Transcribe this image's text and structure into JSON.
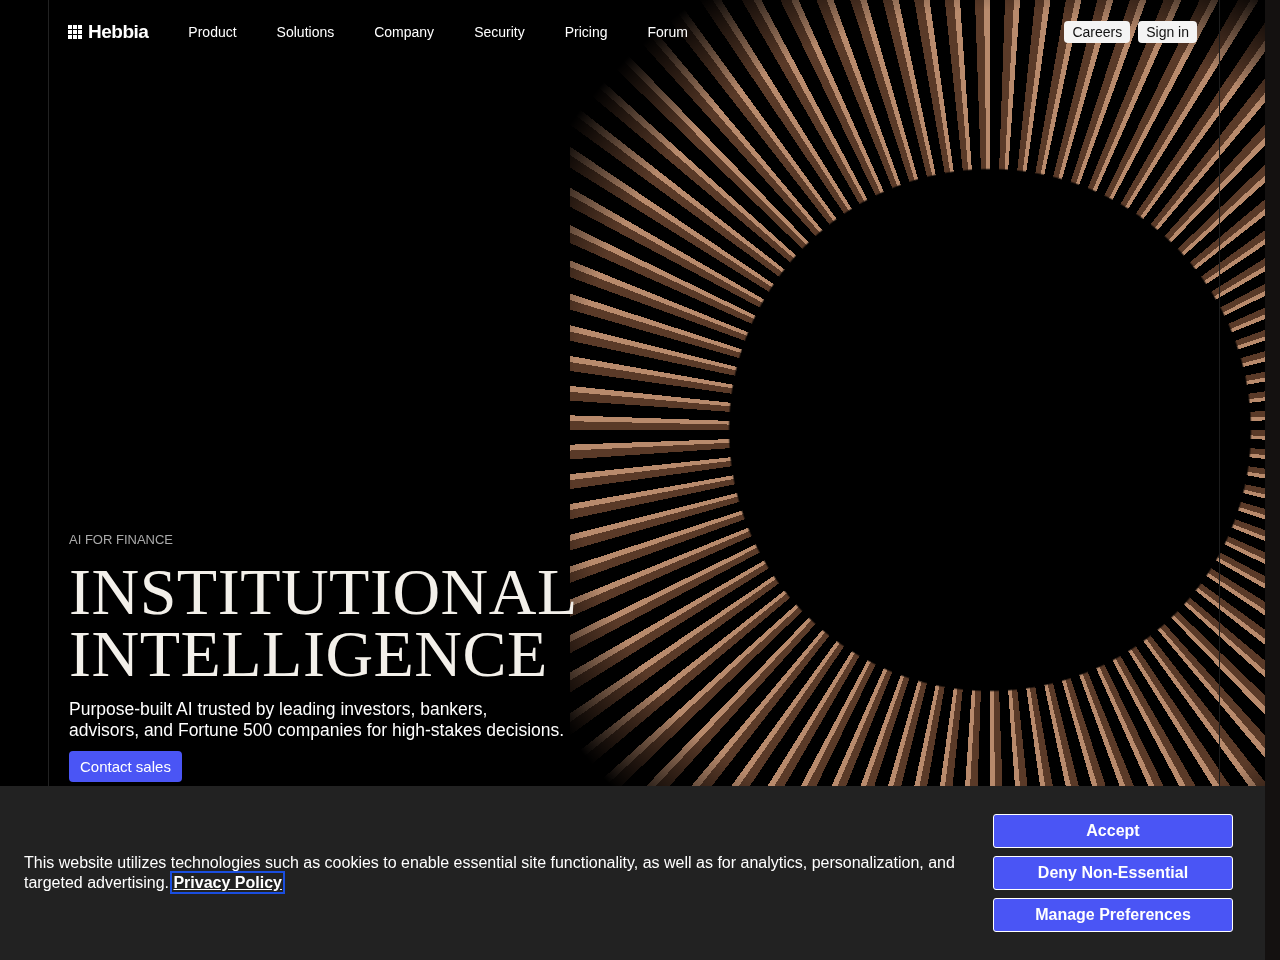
{
  "nav": {
    "logo": "Hebbia",
    "links": [
      "Product",
      "Solutions",
      "Company",
      "Security",
      "Pricing",
      "Forum"
    ],
    "actions": [
      "Careers",
      "Sign in"
    ]
  },
  "hero": {
    "eyebrow": "AI FOR FINANCE",
    "title_lines": [
      "INSTITUTIONAL",
      "INTELLIGENCE"
    ],
    "subtitle_lines": [
      "Purpose-built AI trusted by leading investors, bankers,",
      "advisors, and Fortune 500 companies for high-stakes decisions."
    ],
    "cta": "Contact sales"
  },
  "cookie_banner": {
    "text": "This website utilizes technologies such as cookies to enable essential site functionality, as well as for analytics, personalization, and targeted advertising.",
    "link": "Privacy Policy",
    "buttons": [
      "Accept",
      "Deny Non-Essential",
      "Manage Preferences"
    ]
  }
}
